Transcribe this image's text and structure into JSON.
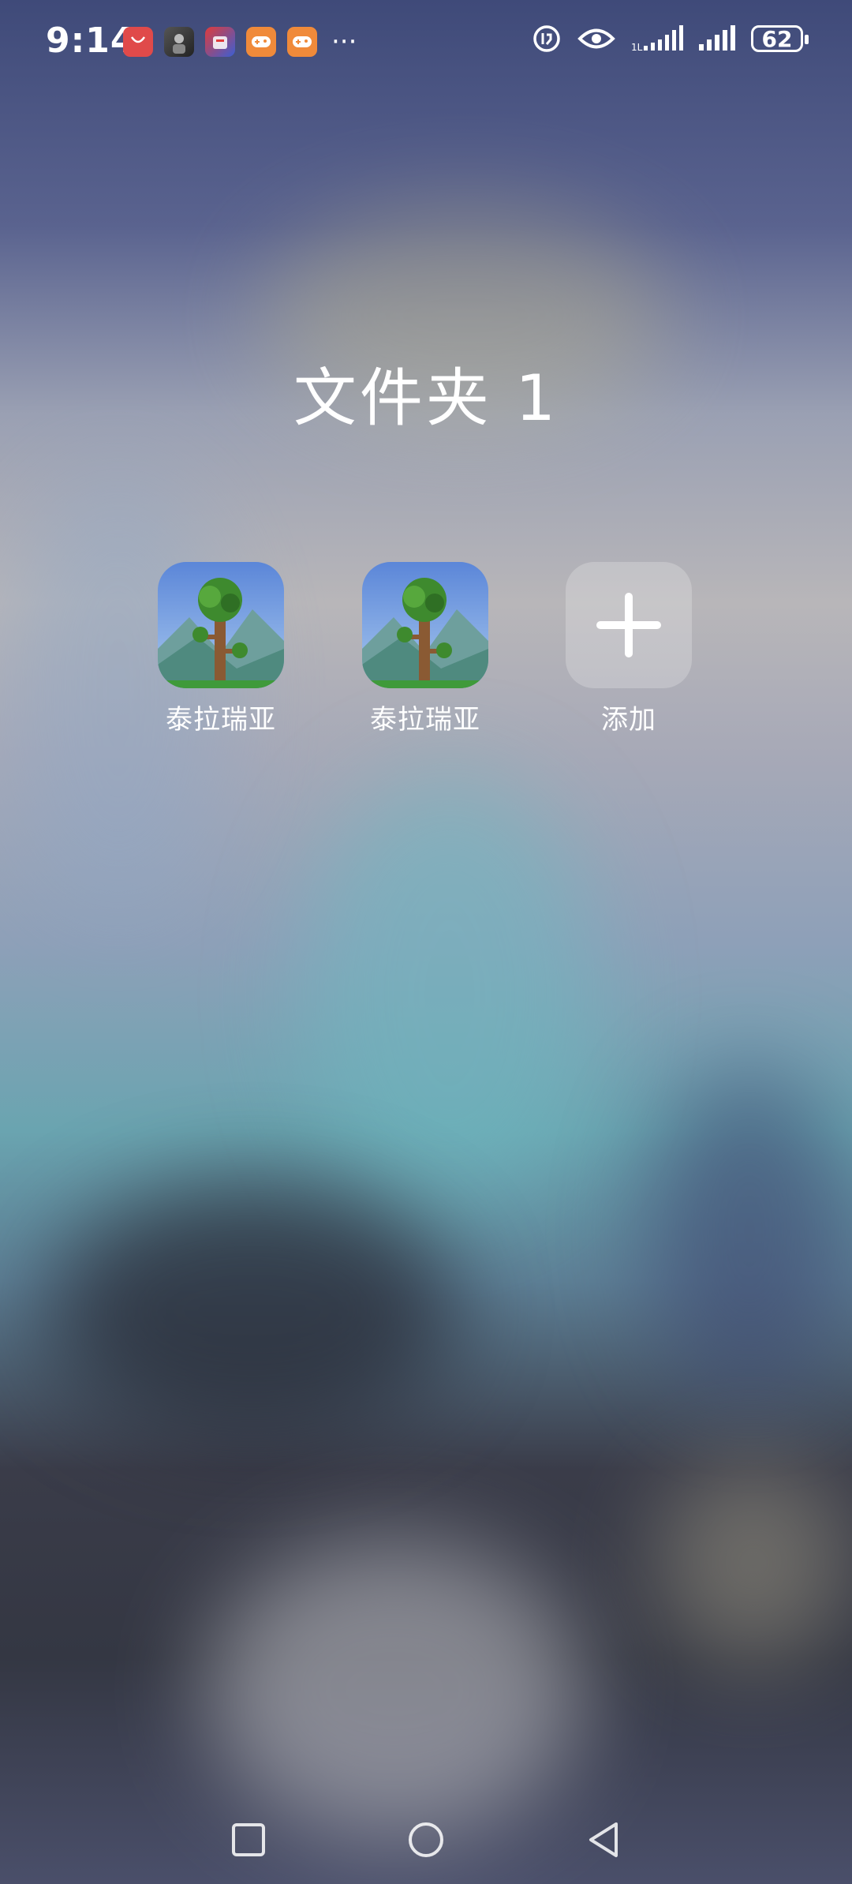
{
  "status_bar": {
    "time": "9:14",
    "notification_icons": [
      "huawei-appgallery-icon",
      "game-avatar-icon",
      "shopping-app-icon",
      "game-center-icon",
      "game-center-icon"
    ],
    "more_indicator": "···",
    "battery_level": "62"
  },
  "folder": {
    "title": "文件夹 1",
    "apps": [
      {
        "label": "泰拉瑞亚",
        "icon": "terraria-tree-icon"
      },
      {
        "label": "泰拉瑞亚",
        "icon": "terraria-tree-icon"
      }
    ],
    "add_label": "添加"
  },
  "nav_bar": {
    "recent": "square-icon",
    "home": "circle-icon",
    "back": "triangle-back-icon"
  }
}
